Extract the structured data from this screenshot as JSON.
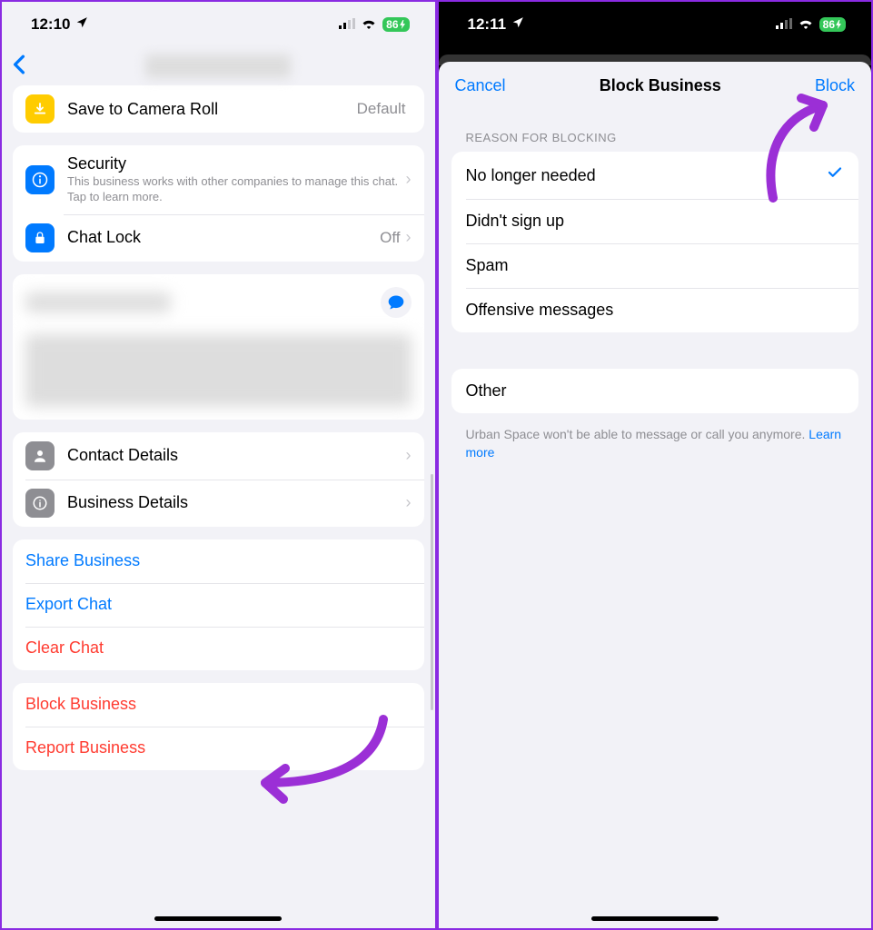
{
  "left": {
    "status": {
      "time": "12:10",
      "battery": "86"
    },
    "settings": {
      "save_camera": {
        "label": "Save to Camera Roll",
        "value": "Default"
      },
      "security": {
        "label": "Security",
        "sub": "This business works with other companies to manage this chat. Tap to learn more."
      },
      "chat_lock": {
        "label": "Chat Lock",
        "value": "Off"
      },
      "contact_details": "Contact Details",
      "business_details": "Business Details",
      "share_business": "Share Business",
      "export_chat": "Export Chat",
      "clear_chat": "Clear Chat",
      "block_business": "Block Business",
      "report_business": "Report Business"
    }
  },
  "right": {
    "status": {
      "time": "12:11",
      "battery": "86"
    },
    "sheet": {
      "cancel": "Cancel",
      "title": "Block Business",
      "confirm": "Block",
      "section_header": "REASON FOR BLOCKING",
      "reasons": {
        "r0": "No longer needed",
        "r1": "Didn't sign up",
        "r2": "Spam",
        "r3": "Offensive messages",
        "other": "Other"
      },
      "footer_prefix": "Urban Space won't be able to message or call you anymore. ",
      "footer_link": "Learn more"
    }
  }
}
